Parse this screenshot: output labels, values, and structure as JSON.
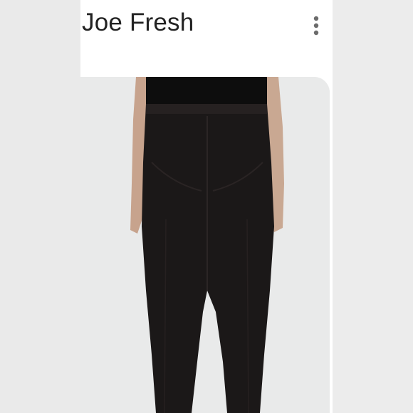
{
  "header": {
    "brand_title": "Joe Fresh",
    "menu_icon": "vertical-ellipsis-icon"
  },
  "product_image": {
    "subject": "black-leggings-back-view",
    "colors": {
      "garment": "#1b1818",
      "top": "#0d0d0d",
      "skin": "#c9a892",
      "background": "#e9eaea"
    }
  }
}
